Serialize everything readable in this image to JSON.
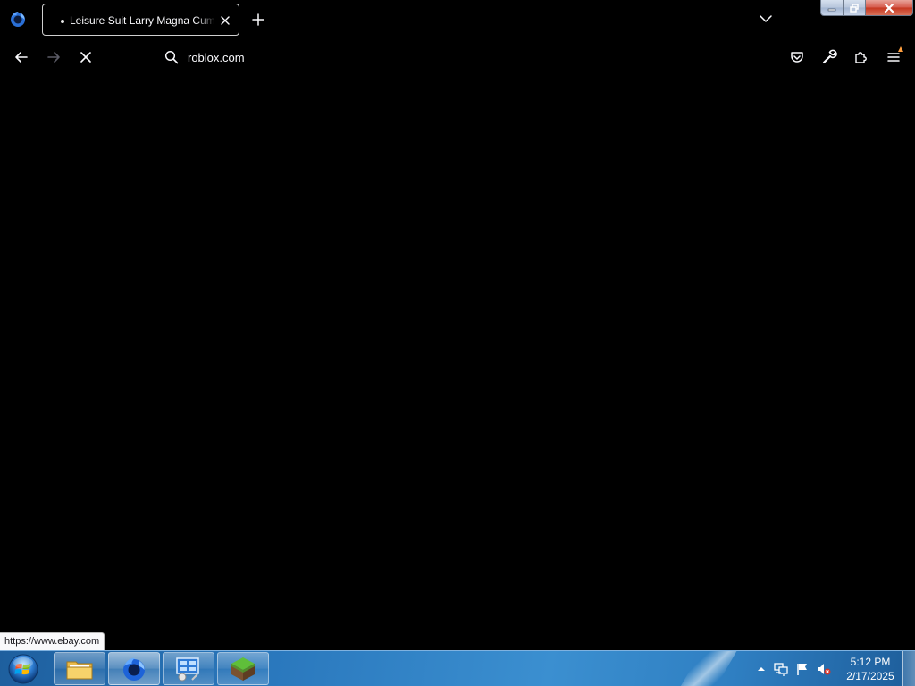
{
  "browser": {
    "tab": {
      "title": "Leisure Suit Larry Magna Cum Laude"
    },
    "urlbar": {
      "value": "roblox.com"
    },
    "status_link": "https://www.ebay.com"
  },
  "taskbar": {
    "clock": {
      "time": "5:12 PM",
      "date": "2/17/2025"
    },
    "pinned": [
      "file-explorer",
      "firefox",
      "control-panel",
      "game"
    ]
  },
  "colors": {
    "page_background": "#000000",
    "chrome_text": "#fbfbfe",
    "taskbar_blue": "#2a78bd",
    "menu_badge": "#ff9f3f"
  }
}
